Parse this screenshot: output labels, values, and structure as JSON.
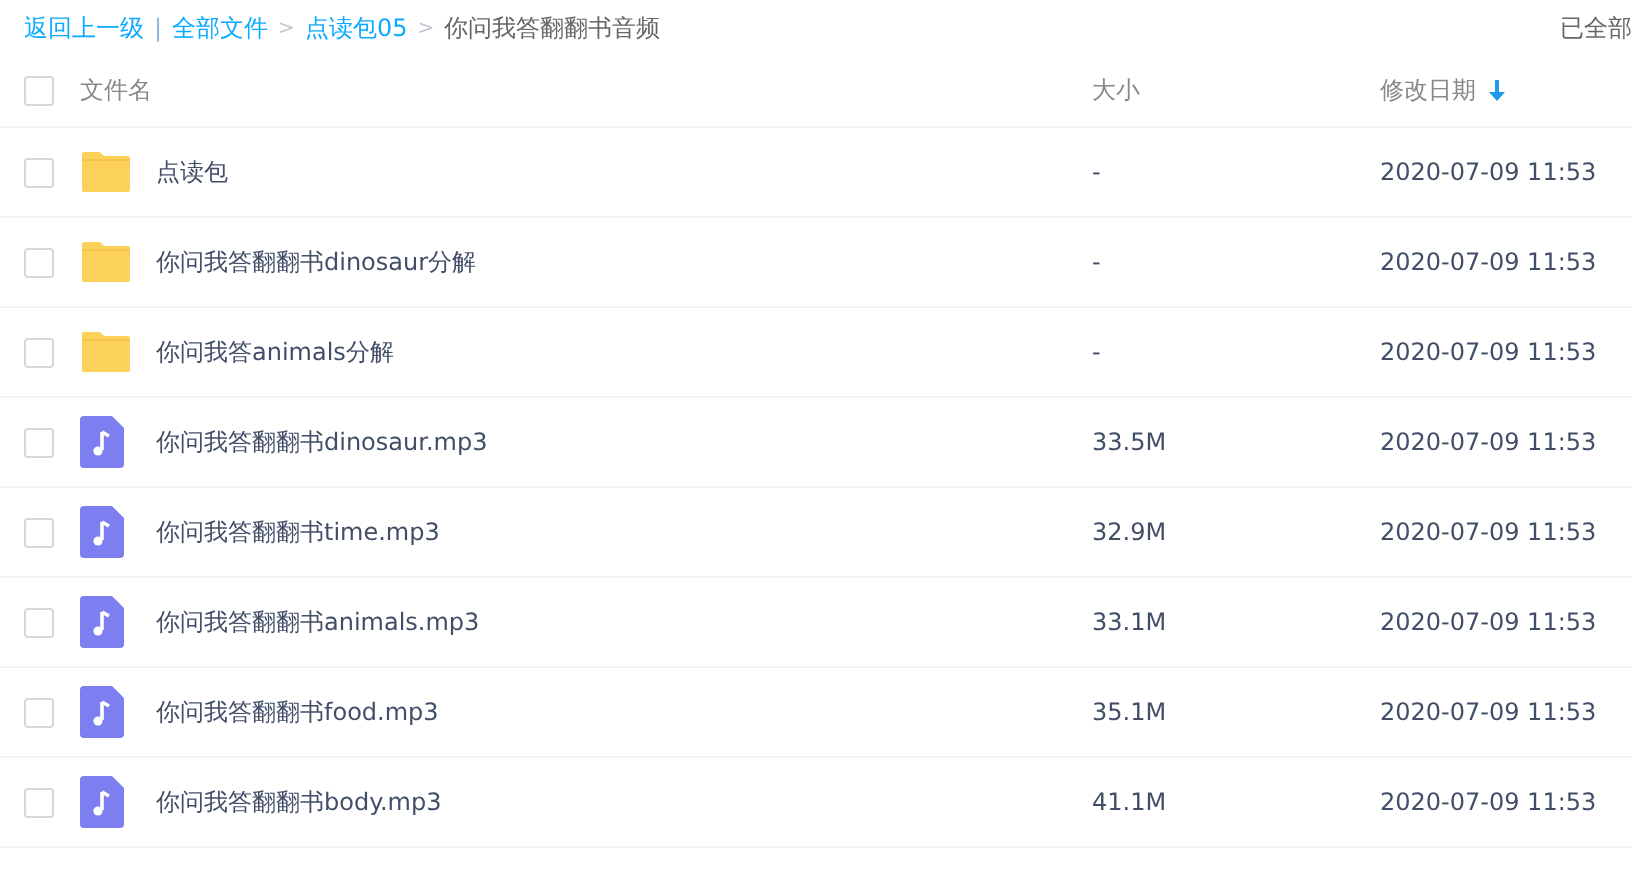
{
  "breadcrumb": {
    "back": "返回上一级",
    "separator": "|",
    "items": [
      {
        "label": "全部文件",
        "link": true
      },
      {
        "label": "点读包05",
        "link": true
      },
      {
        "label": "你问我答翻翻书音频",
        "link": false
      }
    ],
    "arrow": ">"
  },
  "status": "已全部",
  "table": {
    "columns": [
      {
        "label": "文件名"
      },
      {
        "label": "大小"
      },
      {
        "label": "修改日期",
        "sorted": true
      }
    ],
    "rows": [
      {
        "kind": "folder",
        "name": "点读包",
        "size": "-",
        "date": "2020-07-09 11:53",
        "checked": false
      },
      {
        "kind": "folder",
        "name": "你问我答翻翻书dinosaur分解",
        "size": "-",
        "date": "2020-07-09 11:53",
        "checked": false
      },
      {
        "kind": "folder",
        "name": "你问我答animals分解",
        "size": "-",
        "date": "2020-07-09 11:53",
        "checked": false
      },
      {
        "kind": "audio",
        "name": "你问我答翻翻书dinosaur.mp3",
        "size": "33.5M",
        "date": "2020-07-09 11:53",
        "checked": false
      },
      {
        "kind": "audio",
        "name": "你问我答翻翻书time.mp3",
        "size": "32.9M",
        "date": "2020-07-09 11:53",
        "checked": false
      },
      {
        "kind": "audio",
        "name": "你问我答翻翻书animals.mp3",
        "size": "33.1M",
        "date": "2020-07-09 11:53",
        "checked": false
      },
      {
        "kind": "audio",
        "name": "你问我答翻翻书food.mp3",
        "size": "35.1M",
        "date": "2020-07-09 11:53",
        "checked": false
      },
      {
        "kind": "audio",
        "name": "你问我答翻翻书body.mp3",
        "size": "41.1M",
        "date": "2020-07-09 11:53",
        "checked": false
      }
    ],
    "header_checked": false
  }
}
